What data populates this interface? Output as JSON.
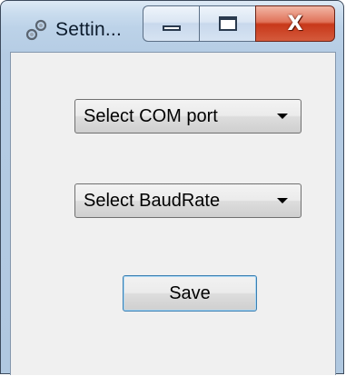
{
  "window": {
    "title": "Settin...",
    "icon": "gear-chain-icon",
    "close_label": "X"
  },
  "form": {
    "com_port_select": {
      "value": "Select COM port"
    },
    "baud_rate_select": {
      "value": "Select BaudRate"
    },
    "save_label": "Save"
  },
  "colors": {
    "close_button": "#c8381a",
    "focus_border": "#3c7fb1"
  }
}
